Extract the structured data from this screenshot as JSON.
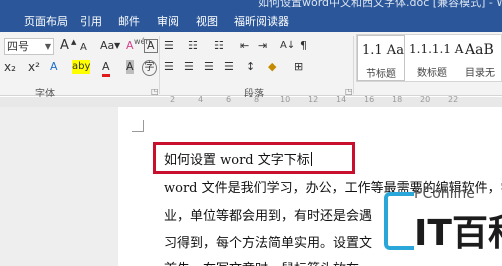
{
  "window": {
    "title": "如何设置word中文和西文字体.doc [兼容模式] - Word"
  },
  "tabs": [
    "页面布局",
    "引用",
    "邮件",
    "审阅",
    "视图",
    "福昕阅读器"
  ],
  "font_group": {
    "size_combo": "四号",
    "label": "字体",
    "grow": "A",
    "shrink": "A",
    "case": "Aa",
    "clear_format": "A",
    "phonetic": "wén",
    "border_char": "A",
    "subscript": "x₂",
    "superscript": "x²",
    "effects": "A",
    "highlight": "aby",
    "font_color": "A",
    "shading": "A",
    "circled": "字"
  },
  "paragraph_group": {
    "label": "段落",
    "sort": "A↓",
    "show_marks": "¶"
  },
  "styles": [
    {
      "sample": "1.1 Aa",
      "name": "节标题"
    },
    {
      "sample": "1.1.1.1 A",
      "name": "数标题"
    },
    {
      "sample": "AaB",
      "name": "目录无"
    }
  ],
  "ruler": {
    "marks": [
      "2",
      "4",
      "6",
      "8",
      "10",
      "12",
      "14",
      "16",
      "18",
      "20",
      "22"
    ]
  },
  "document": {
    "title_line": "如何设置 word 文字下标",
    "lines": [
      "word 文件是我们学习，办公，工作等最需要的编辑软件，学校",
      "业，单位等都会用到，有时还是会遇",
      "习得到，每个方法简单实用。设置文",
      "首先，在写文章时，鼠标箭头放在"
    ]
  },
  "watermark": {
    "top": "PConline",
    "main": "IT百科"
  },
  "colors": {
    "titlebar": "#2b579a",
    "highlight_box": "#c8102e",
    "logo_accent": "#2aa7d8"
  }
}
